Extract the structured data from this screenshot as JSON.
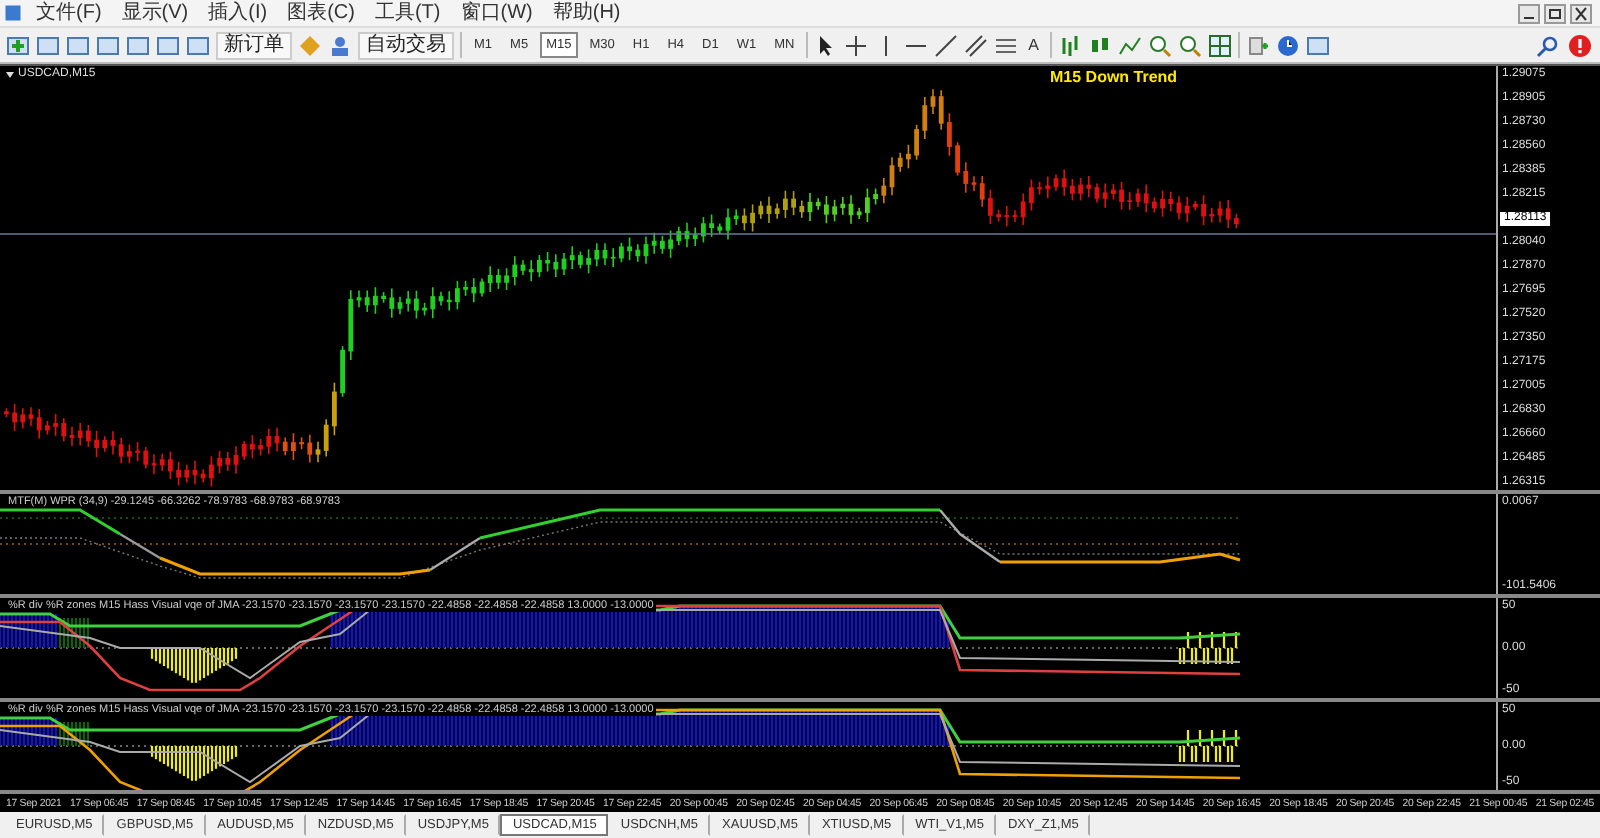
{
  "menu": [
    "文件(F)",
    "显示(V)",
    "插入(I)",
    "图表(C)",
    "工具(T)",
    "窗口(W)",
    "帮助(H)"
  ],
  "toolbar": {
    "new_order": "新订单",
    "auto_trading": "自动交易",
    "text_tool": "A",
    "timeframes": [
      {
        "label": "M1",
        "selected": false
      },
      {
        "label": "M5",
        "selected": false
      },
      {
        "label": "M15",
        "selected": true
      },
      {
        "label": "M30",
        "selected": false
      },
      {
        "label": "H1",
        "selected": false
      },
      {
        "label": "H4",
        "selected": false
      },
      {
        "label": "D1",
        "selected": false
      },
      {
        "label": "W1",
        "selected": false
      },
      {
        "label": "MN",
        "selected": false
      }
    ]
  },
  "chart": {
    "title": "USDCAD,M15",
    "trend_label": "M15 Down Trend",
    "current_price": "1.28113",
    "price_axis": [
      "1.29075",
      "1.28905",
      "1.28730",
      "1.28560",
      "1.28385",
      "1.28215",
      "1.28040",
      "1.27870",
      "1.27695",
      "1.27520",
      "1.27350",
      "1.27175",
      "1.27005",
      "1.26830",
      "1.26660",
      "1.26485",
      "1.26315"
    ]
  },
  "indicators": [
    {
      "label": "MTF(M) WPR (34,9) -29.1245 -66.3262 -78.9783 -68.9783 -68.9783",
      "axis": [
        "0.0067",
        "-101.5406"
      ]
    },
    {
      "label": "%R div %R zones M15 Hass Visual vqe of JMA -23.1570 -23.1570 -23.1570 -23.1570 -22.4858 -22.4858 -22.4858 13.0000 -13.0000",
      "axis": [
        "50",
        "0.00",
        "-50"
      ]
    },
    {
      "label": "%R div %R zones M15 Hass Visual vqe of JMA -23.1570 -23.1570 -23.1570 -23.1570 -22.4858 -22.4858 -22.4858 13.0000 -13.0000",
      "axis": [
        "50",
        "0.00",
        "-50"
      ]
    }
  ],
  "time_axis": [
    "17 Sep 2021",
    "17 Sep 06:45",
    "17 Sep 08:45",
    "17 Sep 10:45",
    "17 Sep 12:45",
    "17 Sep 14:45",
    "17 Sep 16:45",
    "17 Sep 18:45",
    "17 Sep 20:45",
    "17 Sep 22:45",
    "20 Sep 00:45",
    "20 Sep 02:45",
    "20 Sep 04:45",
    "20 Sep 06:45",
    "20 Sep 08:45",
    "20 Sep 10:45",
    "20 Sep 12:45",
    "20 Sep 14:45",
    "20 Sep 16:45",
    "20 Sep 18:45",
    "20 Sep 20:45",
    "20 Sep 22:45",
    "21 Sep 00:45",
    "21 Sep 02:45"
  ],
  "tabs": [
    {
      "label": "EURUSD,M5",
      "selected": false
    },
    {
      "label": "GBPUSD,M5",
      "selected": false
    },
    {
      "label": "AUDUSD,M5",
      "selected": false
    },
    {
      "label": "NZDUSD,M5",
      "selected": false
    },
    {
      "label": "USDJPY,M5",
      "selected": false
    },
    {
      "label": "USDCAD,M15",
      "selected": true
    },
    {
      "label": "USDCNH,M5",
      "selected": false
    },
    {
      "label": "XAUUSD,M5",
      "selected": false
    },
    {
      "label": "XTIUSD,M5",
      "selected": false
    },
    {
      "label": "WTI_V1,M5",
      "selected": false
    },
    {
      "label": "DXY_Z1,M5",
      "selected": false
    }
  ]
}
